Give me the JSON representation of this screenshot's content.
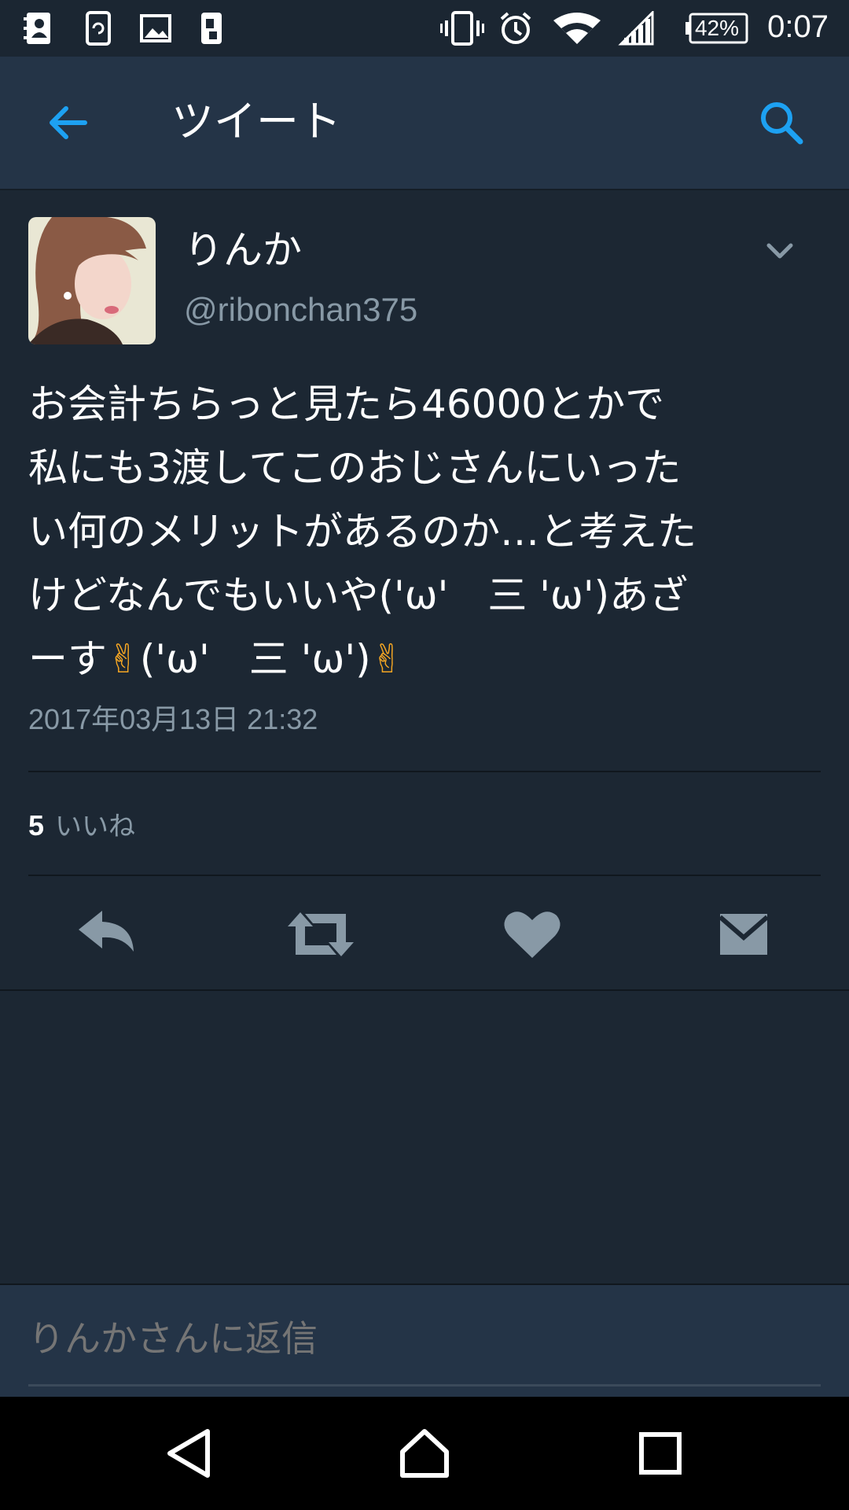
{
  "status_bar": {
    "time": "0:07",
    "battery": "42%",
    "left_icons": [
      "contacts-icon",
      "sync-icon",
      "image-icon",
      "phone-icon"
    ],
    "right_icons": [
      "vibrate-icon",
      "alarm-icon",
      "wifi-icon",
      "signal-icon",
      "battery-icon"
    ]
  },
  "app_bar": {
    "title": "ツイート",
    "back_icon": "arrow-left-icon",
    "search_icon": "search-icon",
    "accent": "#1da1f2"
  },
  "tweet": {
    "name": "りんか",
    "handle": "@ribonchan375",
    "text": "お会計ちらっと見たら46000とかで\n私にも3渡してこのおじさんにいった\nい何のメリットがあるのか…と考えた\nけどなんでもいいや('ω'　三 'ω')あざ\nーす✌('ω'　三 'ω')✌",
    "timestamp": "2017年03月13日 21:32",
    "likes_count": "5",
    "likes_label": "いいね"
  },
  "actions": [
    "reply-icon",
    "retweet-icon",
    "like-icon",
    "direct-message-icon"
  ],
  "reply": {
    "placeholder": "りんかさんに返信"
  },
  "colors": {
    "background": "#1c2733",
    "header": "#243447",
    "muted": "#8899a6",
    "emoji": "#f5a623"
  }
}
